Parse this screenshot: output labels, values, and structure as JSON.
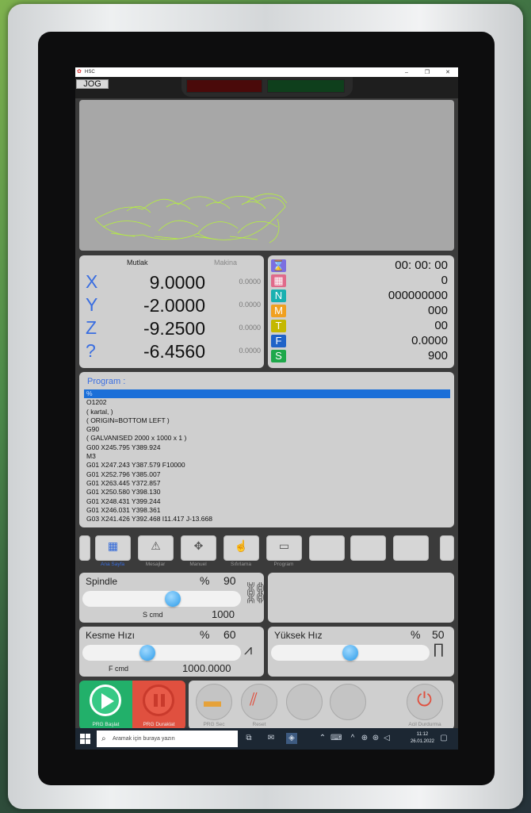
{
  "window": {
    "title": "HSC",
    "minimize": "–",
    "maximize": "❐",
    "close": "✕"
  },
  "mode_button": "JOG",
  "coordinates": {
    "header_abs": "Mutlak",
    "header_machine": "Makina",
    "rows": [
      {
        "axis": "X",
        "abs": "9.0000",
        "machine": "0.0000"
      },
      {
        "axis": "Y",
        "abs": "-2.0000",
        "machine": "0.0000"
      },
      {
        "axis": "Z",
        "abs": "-9.2500",
        "machine": "0.0000"
      },
      {
        "axis": "?",
        "abs": "-6.4560",
        "machine": "0.0000"
      }
    ]
  },
  "status": {
    "rows": [
      {
        "icon": "hourglass-icon",
        "glyph": "⌛",
        "color": "#7b6fe0",
        "value": "00: 00: 00"
      },
      {
        "icon": "counter-icon",
        "glyph": "▦",
        "color": "#e06a8a",
        "value": "0"
      },
      {
        "icon": "n-icon",
        "glyph": "N",
        "color": "#1ab0b0",
        "value": "000000000"
      },
      {
        "icon": "m-icon",
        "glyph": "M",
        "color": "#f0a020",
        "value": "000"
      },
      {
        "icon": "t-icon",
        "glyph": "T",
        "color": "#c4b800",
        "value": "00"
      },
      {
        "icon": "f-icon",
        "glyph": "F",
        "color": "#1f63c8",
        "value": "0.0000"
      },
      {
        "icon": "s-icon",
        "glyph": "S",
        "color": "#1ea84a",
        "value": "900"
      }
    ]
  },
  "program": {
    "label": "Program :",
    "lines": [
      "%",
      "O1202",
      "( kartal, )",
      "( ORIGIN=BOTTOM LEFT )",
      "G90",
      "( GALVANISED 2000 x 1000 x 1 )",
      "G00 X245.795 Y389.924",
      "M3",
      "G01 X247.243 Y387.579 F10000",
      "G01 X252.796 Y385.007",
      "G01 X263.445 Y372.857",
      "G01 X250.580 Y398.130",
      "G01 X248.431 Y399.244",
      "G01 X246.031 Y398.361",
      "G03 X241.426 Y392.468 I11.417 J-13.668"
    ]
  },
  "nav": {
    "items": [
      {
        "label": "Ana Sayfa",
        "icon": "grid-icon"
      },
      {
        "label": "Mesajlar",
        "icon": "message-icon"
      },
      {
        "label": "Manuel",
        "icon": "joystick-icon"
      },
      {
        "label": "Sıfırlama",
        "icon": "home-reset-icon"
      },
      {
        "label": "Program",
        "icon": "program-folder-icon"
      }
    ]
  },
  "spindle": {
    "label": "Spindle",
    "pct_sign": "%",
    "pct": 90,
    "cmd_label": "S cmd",
    "cmd_value": "1000",
    "knob_fraction": 0.58
  },
  "feed": {
    "label": "Kesme Hızı",
    "pct_sign": "%",
    "pct": 60,
    "cmd_label": "F cmd",
    "cmd_value": "1000.0000",
    "knob_fraction": 0.4
  },
  "rapid": {
    "label": "Yüksek Hız",
    "pct_sign": "%",
    "pct": 50,
    "knob_fraction": 0.5
  },
  "controls": {
    "start_label": "PRG Başlat",
    "pause_label": "PRG Duraklat",
    "select_label": "PRG Sec",
    "reset_label": "Reset",
    "estop_label": "Acil Durdurma"
  },
  "taskbar": {
    "search_placeholder": "Aramak için buraya yazın",
    "time": "11:12",
    "date": "26.01.2022"
  },
  "colors": {
    "accent": "#3a6ee0",
    "selected_line": "#1b6fd8",
    "start": "#22b06a",
    "pause": "#e0503f"
  }
}
